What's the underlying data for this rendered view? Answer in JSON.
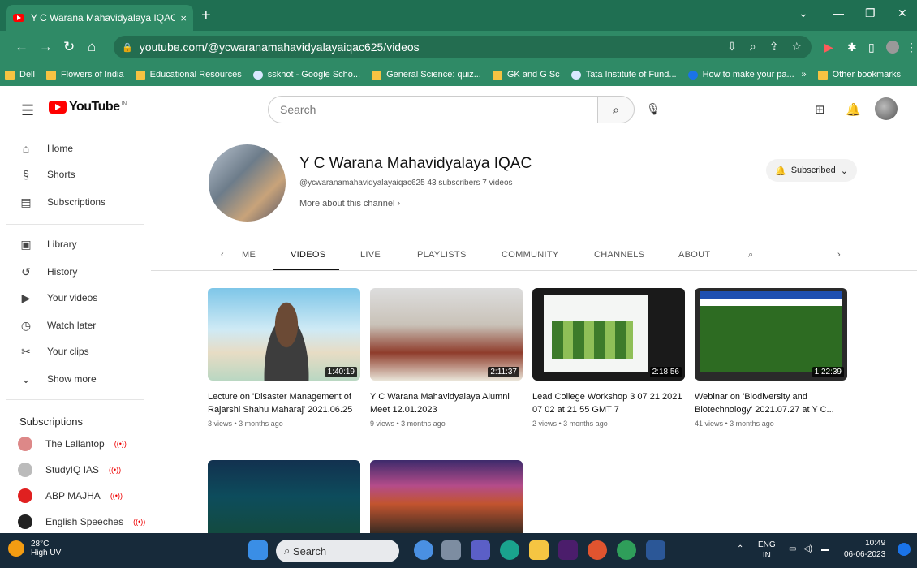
{
  "browser": {
    "tab_title": "Y C Warana Mahavidyalaya IQAC - Y",
    "tab_close": "×",
    "new_tab": "+",
    "url": "youtube.com/@ycwaranamahavidyalayaiqac625/videos",
    "bookmarks": [
      "Dell",
      "Flowers of India",
      "Educational Resources",
      "sskhot - Google Scho...",
      "General Science: quiz...",
      "GK and G Sc",
      "Tata Institute of Fund...",
      "How to make your pa..."
    ],
    "bookmarks_more": "»",
    "other_bookmarks": "Other bookmarks"
  },
  "header": {
    "logo_text": "YouTube",
    "logo_sup": "IN",
    "search_placeholder": "Search"
  },
  "sidebar": {
    "main": [
      "Home",
      "Shorts",
      "Subscriptions"
    ],
    "library": [
      "Library",
      "History",
      "Your videos",
      "Watch later",
      "Your clips",
      "Show more"
    ],
    "subscriptions_heading": "Subscriptions",
    "subscriptions": [
      "The Lallantop",
      "StudyIQ IAS",
      "ABP MAJHA",
      "English Speeches"
    ]
  },
  "channel": {
    "name": "Y C Warana Mahavidyalaya IQAC",
    "handle_meta": "@ycwaranamahavidyalayaiqac625  43 subscribers  7 videos",
    "more_about": "More about this channel",
    "subscribed_label": "Subscribed",
    "tabs": [
      "ME",
      "VIDEOS",
      "LIVE",
      "PLAYLISTS",
      "COMMUNITY",
      "CHANNELS",
      "ABOUT"
    ],
    "active_tab": "VIDEOS"
  },
  "videos": [
    {
      "title": "Lecture on 'Disaster Management of Rajarshi Shahu Maharaj' 2021.06.25",
      "meta": "3 views • 3 months ago",
      "duration": "1:40:19"
    },
    {
      "title": "Y C Warana Mahavidyalaya Alumni Meet 12.01.2023",
      "meta": "9 views • 3 months ago",
      "duration": "2:11:37"
    },
    {
      "title": "Lead College Workshop 3 07 21 2021 07 02 at 21 55 GMT 7",
      "meta": "2 views • 3 months ago",
      "duration": "2:18:56"
    },
    {
      "title": "Webinar on 'Biodiversity and Biotechnology' 2021.07.27 at Y C...",
      "meta": "41 views • 3 months ago",
      "duration": "1:22:39"
    }
  ],
  "taskbar": {
    "temp": "28°C",
    "condition": "High UV",
    "search": "Search",
    "lang1": "ENG",
    "lang2": "IN",
    "time": "10:49",
    "date": "06-06-2023"
  }
}
